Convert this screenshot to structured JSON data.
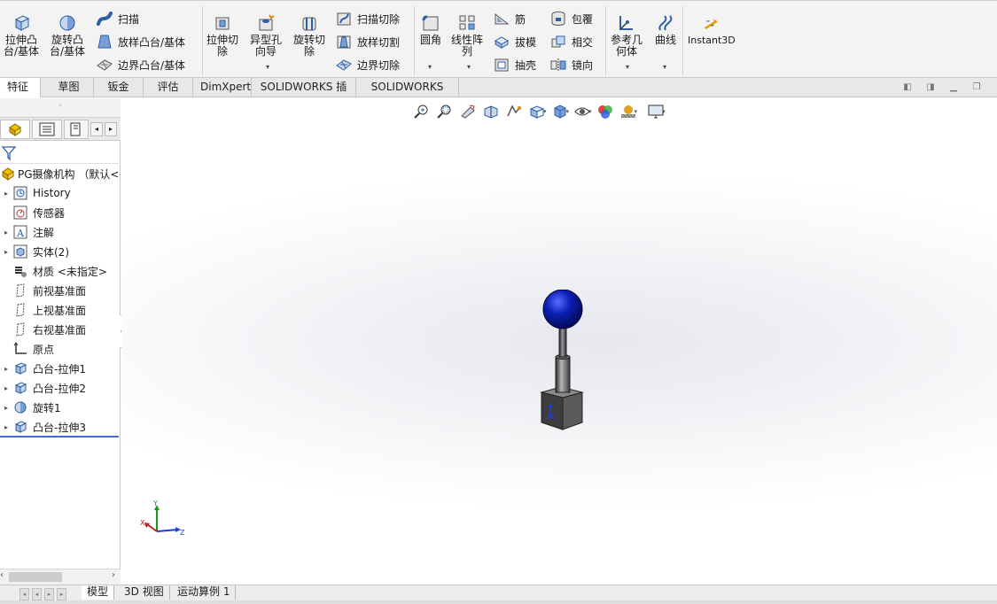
{
  "ribbon": {
    "extrude_boss": "拉伸凸\n台/基体",
    "revolve_boss": "旋转凸\n台/基体",
    "sweep": "扫描",
    "loft_boss": "放样凸台/基体",
    "boundary_boss": "边界凸台/基体",
    "extrude_cut": "拉伸切\n除",
    "hole_wizard": "异型孔\n向导",
    "revolve_cut": "旋转切\n除",
    "sweep_cut": "扫描切除",
    "loft_cut": "放样切割",
    "boundary_cut": "边界切除",
    "fillet": "圆角",
    "linear_pattern": "线性阵\n列",
    "rib": "筋",
    "draft": "拔模",
    "shell": "抽壳",
    "wrap": "包覆",
    "intersect": "相交",
    "mirror": "镜向",
    "ref_geometry": "参考几\n何体",
    "curves": "曲线",
    "instant3d": "Instant3D"
  },
  "command_tabs": [
    "特征",
    "草图",
    "钣金",
    "评估",
    "DimXpert",
    "SOLIDWORKS 插件",
    "SOLIDWORKS MBD"
  ],
  "tree": {
    "root": "PG摄像机构 （默认<<",
    "items": [
      {
        "label": "History",
        "icon": "history-icon",
        "expand": true
      },
      {
        "label": "传感器",
        "icon": "sensor-icon",
        "expand": false
      },
      {
        "label": "注解",
        "icon": "annotation-icon",
        "expand": true
      },
      {
        "label": "实体(2)",
        "icon": "solid-bodies-icon",
        "expand": true
      },
      {
        "label": "材质 <未指定>",
        "icon": "material-icon",
        "expand": false
      },
      {
        "label": "前视基准面",
        "icon": "plane-icon",
        "expand": false
      },
      {
        "label": "上视基准面",
        "icon": "plane-icon",
        "expand": false
      },
      {
        "label": "右视基准面",
        "icon": "plane-icon",
        "expand": false
      },
      {
        "label": "原点",
        "icon": "origin-icon",
        "expand": false
      },
      {
        "label": "凸台-拉伸1",
        "icon": "extrude-feature-icon",
        "expand": true
      },
      {
        "label": "凸台-拉伸2",
        "icon": "extrude-feature-icon",
        "expand": true
      },
      {
        "label": "旋转1",
        "icon": "revolve-feature-icon",
        "expand": true
      },
      {
        "label": "凸台-拉伸3",
        "icon": "extrude-feature-icon",
        "expand": true
      }
    ]
  },
  "triad": {
    "x": "X",
    "y": "Y",
    "z": "Z"
  },
  "bottom_tabs": [
    "模型",
    "3D 视图",
    "运动算例 1"
  ],
  "colors": {
    "accent_blue": "#1f6fd1",
    "ball_blue": "#0a1fb5",
    "ribbon_bg": "#f3f3f3"
  }
}
